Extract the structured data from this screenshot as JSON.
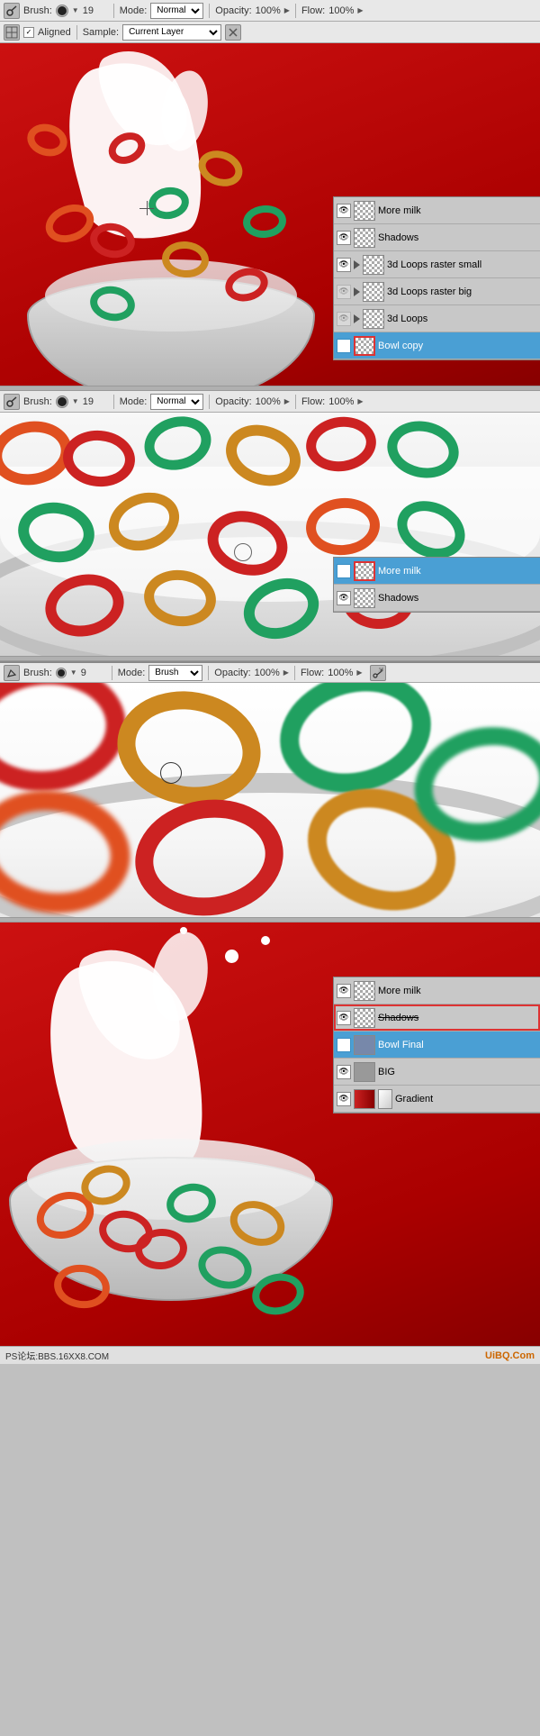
{
  "toolbar1": {
    "brush_label": "Brush:",
    "brush_size": "19",
    "mode_label": "Mode:",
    "mode_value": "Normal",
    "opacity_label": "Opacity:",
    "opacity_value": "100%",
    "flow_label": "Flow:",
    "flow_value": "100%"
  },
  "toolbar2": {
    "aligned_label": "Aligned",
    "sample_label": "Sample:",
    "sample_value": "Current Layer"
  },
  "toolbar3": {
    "brush_label": "Brush:",
    "brush_size": "9",
    "mode_label": "Mode:",
    "mode_value": "Brush",
    "opacity_label": "Opacity:",
    "opacity_value": "100%",
    "flow_label": "Flow:",
    "flow_value": "100%"
  },
  "layers1": {
    "items": [
      {
        "name": "More milk",
        "active": false,
        "type": "checker",
        "eye": true
      },
      {
        "name": "Shadows",
        "active": false,
        "type": "checker",
        "eye": true
      },
      {
        "name": "3d Loops raster small",
        "active": false,
        "type": "play",
        "eye": true
      },
      {
        "name": "3d Loops raster big",
        "active": false,
        "type": "play",
        "eye": false
      },
      {
        "name": "3d Loops",
        "active": false,
        "type": "play",
        "eye": false
      },
      {
        "name": "Bowl copy",
        "active": true,
        "type": "red",
        "eye": true
      }
    ]
  },
  "layers2": {
    "items": [
      {
        "name": "More milk",
        "active": true,
        "type": "checker",
        "eye": true
      },
      {
        "name": "Shadows",
        "active": false,
        "type": "checker",
        "eye": true
      }
    ]
  },
  "layers4": {
    "items": [
      {
        "name": "More milk",
        "active": false,
        "type": "checker",
        "eye": true
      },
      {
        "name": "Shadows",
        "active": false,
        "type": "checker-line",
        "eye": true
      },
      {
        "name": "Bowl Final",
        "active": true,
        "type": "folder",
        "eye": true
      },
      {
        "name": "BIG",
        "active": false,
        "type": "folder-gray",
        "eye": true
      },
      {
        "name": "Gradient",
        "active": false,
        "type": "red-solid",
        "eye": true
      }
    ]
  },
  "bottom": {
    "text": "PS论坛:BBS.16XX8.COM",
    "logo": "UiBQ.Com"
  }
}
